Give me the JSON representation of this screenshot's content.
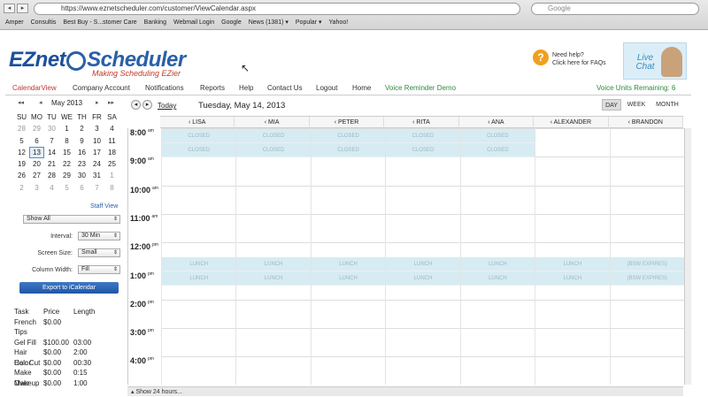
{
  "browser": {
    "url": "https://www.eznetscheduler.com/customer/ViewCalendar.aspx",
    "search_placeholder": "Google",
    "bookmarks": [
      "Amper",
      "Consultis",
      "Best Buy - S...stomer Care",
      "Banking",
      "Webmail Login",
      "Google",
      "News (1381) ▾",
      "Popular ▾",
      "Yahoo!"
    ]
  },
  "header": {
    "logo_ez": "EZnet",
    "logo_rest": "Scheduler",
    "tagline": "Making Scheduling EZier",
    "help_line1": "Need help?",
    "help_line2": "Click here for FAQs",
    "livechat": "Live Chat"
  },
  "menu": {
    "items": [
      "CalendarView",
      "Company Account",
      "Notifications",
      "Reports",
      "Help",
      "Contact Us",
      "Logout",
      "Home",
      "Voice Reminder Demo"
    ],
    "voice_units": "Voice Units Remaining: 6"
  },
  "mini_calendar": {
    "month": "May 2013",
    "prev_year": "◂◂",
    "prev": "◂",
    "next": "▸",
    "next_year": "▸▸",
    "weekdays": [
      "SU",
      "MO",
      "TU",
      "WE",
      "TH",
      "FR",
      "SA"
    ],
    "weeks": [
      [
        "28",
        "29",
        "30",
        "1",
        "2",
        "3",
        "4"
      ],
      [
        "5",
        "6",
        "7",
        "8",
        "9",
        "10",
        "11"
      ],
      [
        "12",
        "13",
        "14",
        "15",
        "16",
        "17",
        "18"
      ],
      [
        "19",
        "20",
        "21",
        "22",
        "23",
        "24",
        "25"
      ],
      [
        "26",
        "27",
        "28",
        "29",
        "30",
        "31",
        "1"
      ],
      [
        "2",
        "3",
        "4",
        "5",
        "6",
        "7",
        "8"
      ]
    ],
    "selected": "13"
  },
  "controls": {
    "staff_view": "Staff View",
    "show_all": "Show All",
    "interval_label": "Interval:",
    "interval_value": "30 Min",
    "screen_size_label": "Screen Size:",
    "screen_size_value": "Small",
    "column_width_label": "Column Width:",
    "column_width_value": "Fill",
    "export": "Export to iCalendar"
  },
  "tasks": {
    "headers": [
      "Task",
      "Price",
      "Length"
    ],
    "rows": [
      [
        "French",
        "$0.00",
        ""
      ],
      [
        "Tips",
        "",
        ""
      ],
      [
        "Gel Fill",
        "$100.00",
        "03:00"
      ],
      [
        "Hair Color",
        "$0.00",
        "2:00"
      ],
      [
        "Hair Cut",
        "$0.00",
        "00:30"
      ],
      [
        "Make Over",
        "$0.00",
        "0:15"
      ],
      [
        "Makeup",
        "$0.00",
        "1:00"
      ]
    ]
  },
  "calendar": {
    "prev": "◂",
    "next": "▸",
    "today": "Today",
    "date_title": "Tuesday, May 14, 2013",
    "views": [
      "DAY",
      "WEEK",
      "MONTH"
    ],
    "staff": [
      "‹ LISA",
      "‹ MIA",
      "‹ PETER",
      "‹ RITA",
      "‹ ANA",
      "‹ ALEXANDER",
      "‹ BRANDON"
    ],
    "hours": [
      {
        "h": "8:00",
        "ap": "am"
      },
      {
        "h": "9:00",
        "ap": "am"
      },
      {
        "h": "10:00",
        "ap": "am"
      },
      {
        "h": "11:00",
        "ap": "am"
      },
      {
        "h": "12:00",
        "ap": "pm"
      },
      {
        "h": "1:00",
        "ap": "pm"
      },
      {
        "h": "2:00",
        "ap": "pm"
      },
      {
        "h": "3:00",
        "ap": "pm"
      },
      {
        "h": "4:00",
        "ap": "pm"
      }
    ],
    "closed_label": "CLOSED",
    "lunch_label": "LUNCH",
    "brandon_label": "(BSW EXPIRES)",
    "show24": "▴ Show 24 hours..."
  }
}
